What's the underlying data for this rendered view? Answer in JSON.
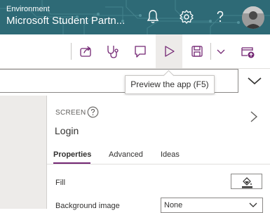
{
  "header": {
    "environment_label": "Environment",
    "environment_name": "Microsoft Student Partn...",
    "background_color": "#2e6a76",
    "icons": [
      "bell-icon",
      "gear-icon",
      "help-icon"
    ]
  },
  "toolbar": {
    "icons": [
      "share-icon",
      "app-checker-icon",
      "comments-icon",
      "preview-play-icon",
      "save-icon",
      "chevron-down-icon",
      "publish-icon"
    ],
    "active": "preview-play-icon"
  },
  "tooltip": {
    "text": "Preview the app (F5)"
  },
  "panel": {
    "kind_label": "SCREEN",
    "screen_name": "Login",
    "tabs": [
      {
        "label": "Properties",
        "active": true
      },
      {
        "label": "Advanced",
        "active": false
      },
      {
        "label": "Ideas",
        "active": false
      }
    ],
    "accent_color": "#742774",
    "fill_label": "Fill",
    "background_image_label": "Background image",
    "background_image_value": "None"
  }
}
